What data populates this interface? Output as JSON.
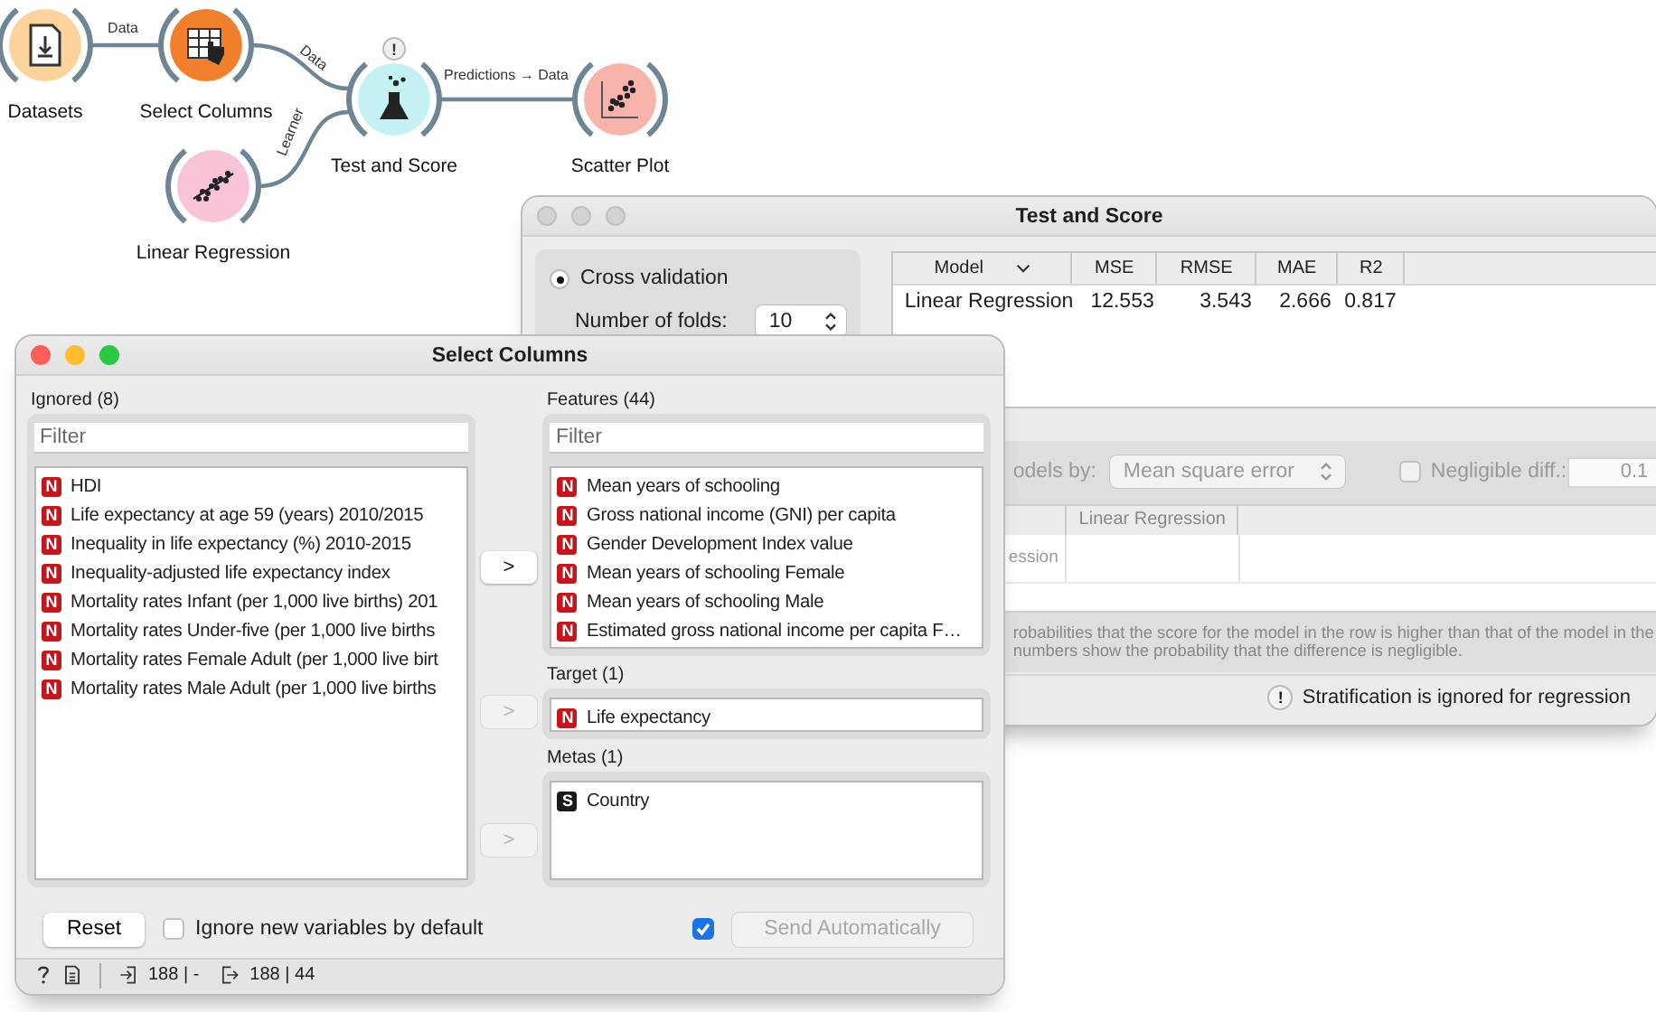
{
  "workflow": {
    "nodes": [
      {
        "label": "Datasets",
        "color": "#fcd39a",
        "kind": "file"
      },
      {
        "label": "Select Columns",
        "color": "#f27f2c",
        "kind": "table"
      },
      {
        "label": "Test and Score",
        "color": "#c4f1f1",
        "kind": "flask",
        "warning": "!"
      },
      {
        "label": "Scatter Plot",
        "color": "#f8b4aa",
        "kind": "scatter"
      },
      {
        "label": "Linear Regression",
        "color": "#f9c3d8",
        "kind": "regression"
      }
    ],
    "links": [
      {
        "label": "Data"
      },
      {
        "label": "Data"
      },
      {
        "label": "Learner"
      },
      {
        "label": "Predictions → Data"
      }
    ]
  },
  "test_and_score": {
    "title": "Test and Score",
    "sampling": [
      {
        "label": "Cross validation",
        "selected": true
      }
    ],
    "folds": {
      "label": "Number of folds:",
      "value": "10"
    },
    "results": {
      "columns": [
        "Model",
        "MSE",
        "RMSE",
        "MAE",
        "R2"
      ],
      "rows": [
        [
          "Linear Regression",
          "12.553",
          "3.543",
          "2.666",
          "0.817"
        ]
      ]
    },
    "comparison": {
      "disabled": true,
      "compare_label": "odels by:",
      "compare_value": "Mean square error",
      "negligible": {
        "label": "Negligible diff.:",
        "checked": false,
        "value": "0.1"
      },
      "columns": [
        "Linear Regression"
      ],
      "rows": [
        "ession"
      ],
      "note": [
        "robabilities that the score for the model in the row is higher than that of the model in the",
        "numbers show the probability that the difference is negligible."
      ]
    },
    "status": {
      "icon": "!",
      "text": "Stratification is ignored for regression"
    }
  },
  "select_columns": {
    "title": "Select Columns",
    "ignored": {
      "label": "Ignored (8)",
      "placeholder": "Filter",
      "items": [
        {
          "type": "N",
          "name": "HDI"
        },
        {
          "type": "N",
          "name": "Life expectancy at age 59 (years) 2010/2015"
        },
        {
          "type": "N",
          "name": "Inequality in life expectancy (%) 2010-2015"
        },
        {
          "type": "N",
          "name": "Inequality-adjusted life expectancy index"
        },
        {
          "type": "N",
          "name": "Mortality rates Infant (per 1,000 live births) 201"
        },
        {
          "type": "N",
          "name": "Mortality rates Under-five (per 1,000 live births"
        },
        {
          "type": "N",
          "name": "Mortality rates Female Adult (per 1,000 live birt"
        },
        {
          "type": "N",
          "name": "Mortality rates Male Adult (per 1,000 live births"
        }
      ]
    },
    "features": {
      "label": "Features (44)",
      "placeholder": "Filter",
      "items": [
        {
          "type": "N",
          "name": "Mean years of schooling"
        },
        {
          "type": "N",
          "name": "Gross national income (GNI) per capita"
        },
        {
          "type": "N",
          "name": "Gender Development Index value"
        },
        {
          "type": "N",
          "name": "Mean years of schooling Female"
        },
        {
          "type": "N",
          "name": "Mean years of schooling Male"
        },
        {
          "type": "N",
          "name": "Estimated gross national income per capita F…"
        }
      ]
    },
    "target": {
      "label": "Target (1)",
      "items": [
        {
          "type": "N",
          "name": "Life expectancy"
        }
      ]
    },
    "metas": {
      "label": "Metas (1)",
      "items": [
        {
          "type": "S",
          "name": "Country"
        }
      ]
    },
    "move_buttons": [
      {
        "label": ">",
        "disabled": false
      },
      {
        "label": ">",
        "disabled": true
      },
      {
        "label": ">",
        "disabled": true
      }
    ],
    "reset": "Reset",
    "ignore_new": {
      "label": "Ignore new variables by default",
      "checked": false
    },
    "auto_send": {
      "checked": true,
      "label": "Send Automatically",
      "disabled": true
    },
    "status": {
      "input": "188 | -",
      "output": "188 | 44"
    }
  }
}
